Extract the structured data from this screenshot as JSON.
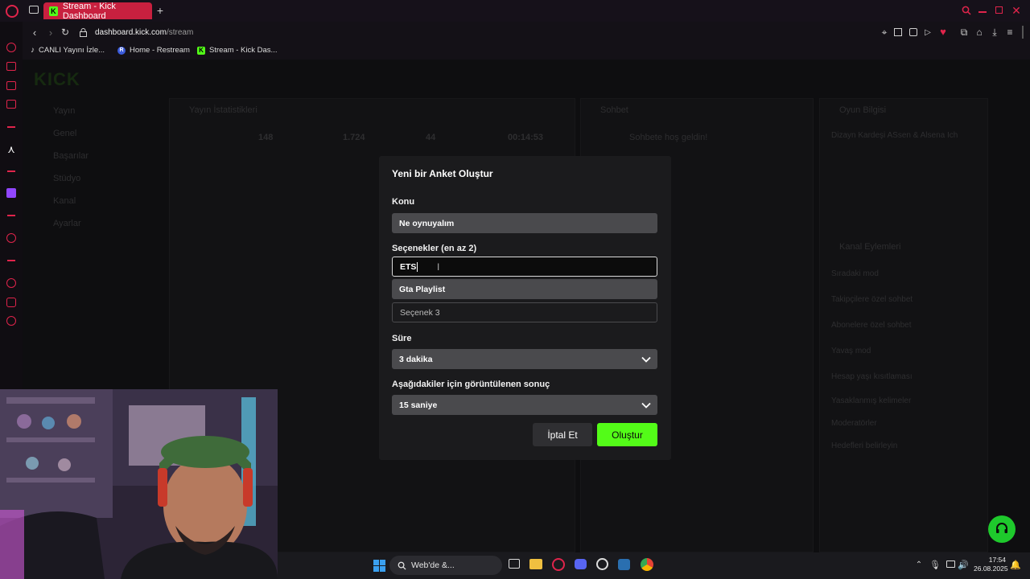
{
  "browser": {
    "tab_title": "Stream - Kick Dashboard",
    "new_tab": "+",
    "url_domain": "dashboard.kick.com",
    "url_path": "/stream",
    "bookmarks": [
      {
        "label": "CANLI Yayını İzle..."
      },
      {
        "label": "Home - Restream"
      },
      {
        "label": "Stream - Kick Das..."
      }
    ]
  },
  "dashboard": {
    "logo": "KICK",
    "nav": [
      "Yayın",
      "Genel",
      "Başarılar",
      "Stüdyo",
      "Kanal",
      "Ayarlar"
    ],
    "panels": [
      "Yayın İstatistikleri",
      "Sohbet",
      "Oyun Bilgisi"
    ],
    "stats": [
      "148",
      "1.724",
      "44",
      "00:14:53"
    ],
    "chat_welcome": "Sohbete hoş geldin!",
    "stream_title": "Dizayn Kardeşi ASsen & Alsena Ich",
    "right_items": [
      "Kanal Eylemleri",
      "Sıradaki mod",
      "Takipçilere özel sohbet",
      "Abonelere özel sohbet",
      "Yavaş mod",
      "Hesap yaşı kısıtlaması",
      "Yasaklanmış kelimeler",
      "Moderatörler",
      "Hedefleri belirleyin"
    ]
  },
  "modal": {
    "title": "Yeni bir Anket Oluştur",
    "topic_label": "Konu",
    "topic_value": "Ne oynuyalım",
    "options_label": "Seçenekler (en az 2)",
    "option1_value": "ETS",
    "option2_value": "Gta Playlist",
    "option3_placeholder": "Seçenek 3",
    "duration_label": "Süre",
    "duration_value": "3 dakika",
    "result_label": "Aşağıdakiler için görüntülenen sonuç",
    "result_value": "15 saniye",
    "cancel_label": "İptal Et",
    "create_label": "Oluştur"
  },
  "taskbar": {
    "search_text": "Web'de &...",
    "time": "17:54",
    "date": "26.08.2025"
  },
  "colors": {
    "kick_green": "#53fc18",
    "browser_accent": "#c8203f",
    "modal_bg": "#1b1b1d"
  }
}
